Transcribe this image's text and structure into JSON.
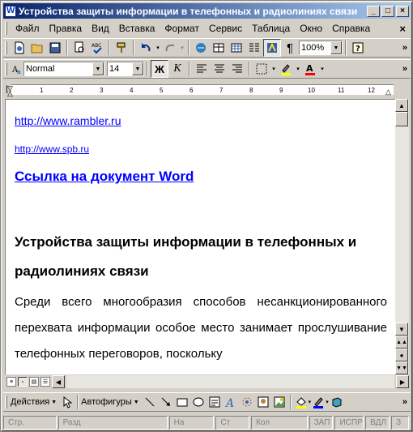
{
  "title": "Устройства защиты информации в телефонных и радиолиниях связи",
  "menu": [
    "Файл",
    "Правка",
    "Вид",
    "Вставка",
    "Формат",
    "Сервис",
    "Таблица",
    "Окно",
    "Справка"
  ],
  "toolbar": {
    "zoom": "100%"
  },
  "format": {
    "style": "Normal",
    "size": "14",
    "bold": "Ж",
    "italic": "К"
  },
  "ruler": {
    "ticks": [
      "1",
      "2",
      "3",
      "4",
      "5",
      "6",
      "7",
      "8",
      "9",
      "10",
      "11",
      "12"
    ]
  },
  "document": {
    "link1": "http://www.rambler.ru",
    "link2": "http://www.spb.ru",
    "link3": "Ссылка на документ Word",
    "heading": "Устройства защиты информации в телефонных и радиолиниях связи",
    "paragraph": "Среди всего многообразия способов несанкционированного перехвата информации особое место занимает прослушивание телефонных переговоров, поскольку"
  },
  "drawing": {
    "actions": "Действия",
    "autoshapes": "Автофигуры"
  },
  "status": {
    "page": "Стр.",
    "section": "Разд",
    "at": "На",
    "line": "Ст",
    "col": "Кол",
    "rec": "ЗАП",
    "trk": "ИСПР",
    "ext": "ВДЛ",
    "ovr": "З"
  },
  "colors": {
    "titleStart": "#0a246a",
    "titleEnd": "#a6caf0",
    "link": "#0000ff",
    "highlight": "#ffff00",
    "fontColor": "#ff0000"
  }
}
